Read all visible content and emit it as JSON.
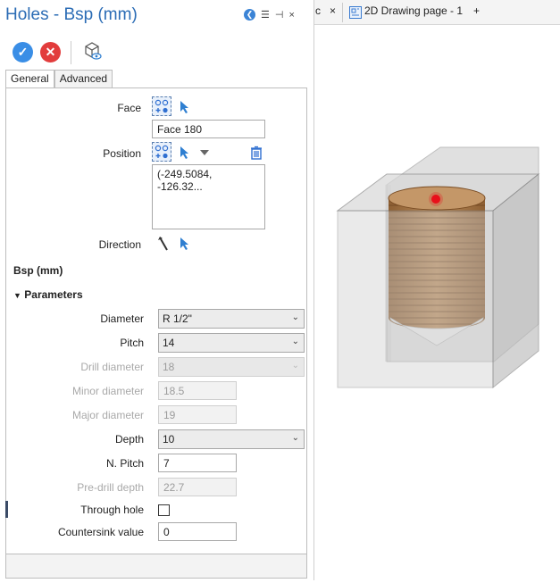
{
  "panel": {
    "title": "Holes - Bsp (mm)",
    "pin_glyph": "⊣",
    "close_glyph": "×"
  },
  "tabs": [
    "General",
    "Advanced"
  ],
  "face": {
    "label": "Face",
    "value": "Face 180"
  },
  "position": {
    "label": "Position",
    "value": "(-249.5084, -126.32..."
  },
  "direction": {
    "label": "Direction"
  },
  "type_heading": "Bsp (mm)",
  "parameters_heading": "Parameters",
  "params": {
    "diameter": {
      "label": "Diameter",
      "value": "R 1/2\""
    },
    "pitch": {
      "label": "Pitch",
      "value": "14"
    },
    "drill_diameter": {
      "label": "Drill diameter",
      "value": "18"
    },
    "minor_diameter": {
      "label": "Minor diameter",
      "value": "18.5"
    },
    "major_diameter": {
      "label": "Major diameter",
      "value": "19"
    },
    "depth": {
      "label": "Depth",
      "value": "10"
    },
    "n_pitch": {
      "label": "N. Pitch",
      "value": "7"
    },
    "pre_drill_depth": {
      "label": "Pre-drill depth",
      "value": "22.7"
    },
    "through_hole": {
      "label": "Through hole",
      "checked": false
    },
    "countersink": {
      "label": "Countersink value",
      "value": "0"
    }
  },
  "doc_tabs": {
    "partial": "c",
    "close_glyph": "×",
    "drawing": "2D Drawing page - 1",
    "add_glyph": "+"
  },
  "colors": {
    "accent": "#2b6cb5",
    "ok": "#3a8ee6",
    "cancel": "#e23c3c",
    "hole": "#a0703e",
    "marker": "#e8101a"
  }
}
